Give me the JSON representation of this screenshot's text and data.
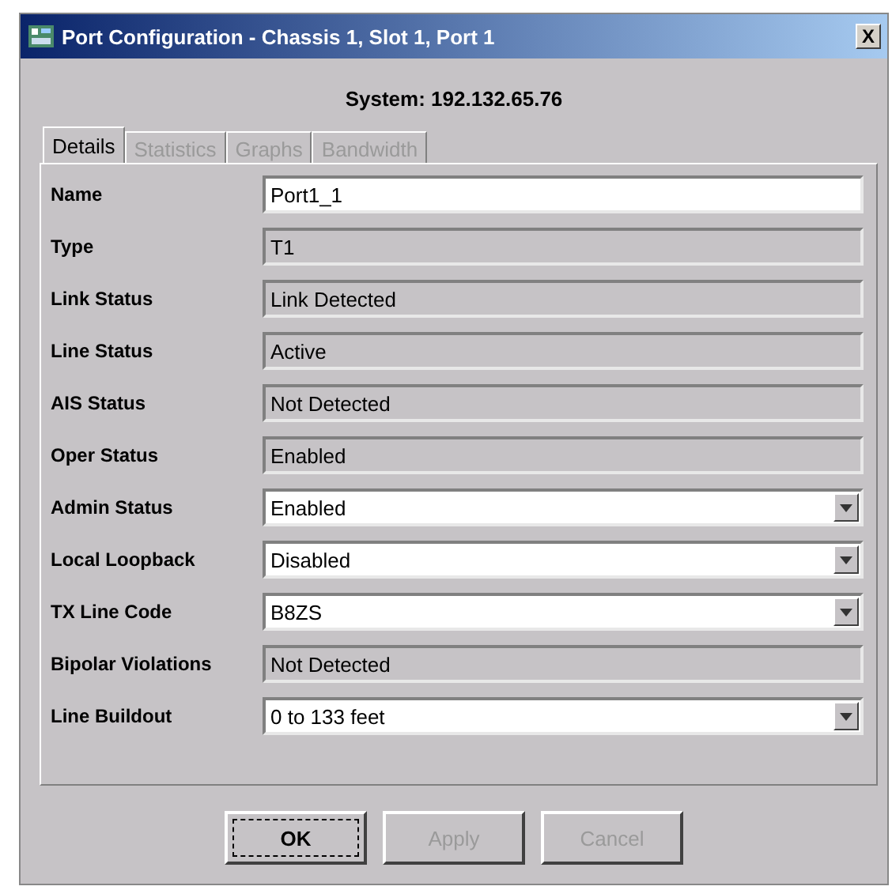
{
  "window": {
    "title": "Port Configuration - Chassis 1, Slot 1, Port 1",
    "close": "X"
  },
  "system": "System: 192.132.65.76",
  "tabs": [
    {
      "label": "Details",
      "selected": true,
      "disabled": false
    },
    {
      "label": "Statistics",
      "selected": false,
      "disabled": true
    },
    {
      "label": "Graphs",
      "selected": false,
      "disabled": true
    },
    {
      "label": "Bandwidth",
      "selected": false,
      "disabled": true
    }
  ],
  "fields": [
    {
      "label": "Name",
      "kind": "text",
      "value": "Port1_1"
    },
    {
      "label": "Type",
      "kind": "readonly",
      "value": "T1"
    },
    {
      "label": "Link Status",
      "kind": "readonly",
      "value": "Link Detected"
    },
    {
      "label": "Line Status",
      "kind": "readonly",
      "value": "Active"
    },
    {
      "label": "AIS Status",
      "kind": "readonly",
      "value": "Not Detected"
    },
    {
      "label": "Oper Status",
      "kind": "readonly",
      "value": "Enabled"
    },
    {
      "label": "Admin Status",
      "kind": "select",
      "value": "Enabled"
    },
    {
      "label": "Local Loopback",
      "kind": "select",
      "value": "Disabled"
    },
    {
      "label": "TX Line Code",
      "kind": "select",
      "value": "B8ZS"
    },
    {
      "label": "Bipolar Violations",
      "kind": "readonly",
      "value": "Not Detected"
    },
    {
      "label": "Line Buildout",
      "kind": "select",
      "value": "0 to 133 feet"
    }
  ],
  "buttons": [
    {
      "label": "OK",
      "disabled": false,
      "focused": true
    },
    {
      "label": "Apply",
      "disabled": true,
      "focused": false
    },
    {
      "label": "Cancel",
      "disabled": true,
      "focused": false
    }
  ]
}
